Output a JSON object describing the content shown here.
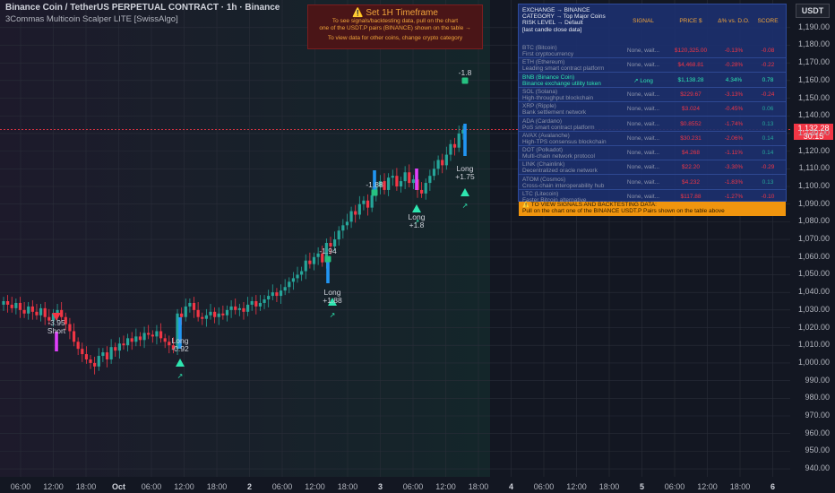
{
  "header": {
    "title": "Binance Coin / TetherUS PERPETUAL CONTRACT · 1h · Binance",
    "indicator": "3Commas Multicoin Scalper LITE [SwissAlgo]",
    "currency": "USDT"
  },
  "price_tag": {
    "price": "1,132.28",
    "countdown": "30:15"
  },
  "warning": {
    "title": "⚠️  Set 1H Timeframe",
    "line1": "To see signals/backtesting data, pull on the chart",
    "line2": "one of the USDT.P pairs (BINANCE) shown on the table →",
    "line3": "To view data for other coins, change crypto category"
  },
  "info_table": {
    "header_lines": [
      "EXCHANGE → BINANCE",
      "CATEGORY → Top Major Coins",
      "RISK LEVEL → Default"
    ],
    "note": "[last candle close data]",
    "columns": [
      "SIGNAL",
      "PRICE $",
      "Δ% vs. D.O.",
      "SCORE"
    ],
    "rows": [
      {
        "name": "BTC (Bitcoin)",
        "desc": "First cryptocurrency",
        "signal": "None, wait...",
        "price": "$120,325.00",
        "delta": "-0.13%",
        "score": "-0.08",
        "score_neg": true
      },
      {
        "name": "ETH (Ethereum)",
        "desc": "Leading smart contract platform",
        "signal": "None, wait...",
        "price": "$4,468.81",
        "delta": "-0.28%",
        "score": "-0.22",
        "score_neg": true
      },
      {
        "name": "BNB (Binance Coin)",
        "desc": "Binance exchange utility token",
        "signal": "↗ Long",
        "price": "$1,138.28",
        "delta": "4.34%",
        "score": "0.78",
        "score_neg": false,
        "highlight": true
      },
      {
        "name": "SOL (Solana)",
        "desc": "High-throughput blockchain",
        "signal": "None, wait...",
        "price": "$229.67",
        "delta": "-3.13%",
        "score": "-0.24",
        "score_neg": true
      },
      {
        "name": "XRP (Ripple)",
        "desc": "Bank settlement network",
        "signal": "None, wait...",
        "price": "$3.024",
        "delta": "-0.45%",
        "score": "0.06",
        "score_neg": false
      },
      {
        "name": "ADA (Cardano)",
        "desc": "PoS smart contract platform",
        "signal": "None, wait...",
        "price": "$0.8552",
        "delta": "-1.74%",
        "score": "0.13",
        "score_neg": false
      },
      {
        "name": "AVAX (Avalanche)",
        "desc": "High-TPS consensus blockchain",
        "signal": "None, wait...",
        "price": "$30.231",
        "delta": "-2.06%",
        "score": "0.14",
        "score_neg": false
      },
      {
        "name": "DOT (Polkadot)",
        "desc": "Multi-chain network protocol",
        "signal": "None, wait...",
        "price": "$4.268",
        "delta": "-1.11%",
        "score": "0.14",
        "score_neg": false
      },
      {
        "name": "LINK (Chainlink)",
        "desc": "Decentralized oracle network",
        "signal": "None, wait...",
        "price": "$22.20",
        "delta": "-3.30%",
        "score": "-0.29",
        "score_neg": true
      },
      {
        "name": "ATOM (Cosmos)",
        "desc": "Cross-chain interoperability hub",
        "signal": "None, wait...",
        "price": "$4.232",
        "delta": "-1.83%",
        "score": "0.13",
        "score_neg": false
      },
      {
        "name": "LTC (Litecoin)",
        "desc": "Faster Bitcoin alternative",
        "signal": "None, wait...",
        "price": "$117.88",
        "delta": "-1.27%",
        "score": "-0.10",
        "score_neg": true
      }
    ],
    "footer_line1": "⚠️  TO VIEW SIGNALS AND BACKTESTING DATA:",
    "footer_line2": "Pull on the chart one of the BINANCE USDT.P Pairs shown on the table above"
  },
  "chart_data": {
    "type": "candlestick",
    "y_axis_ticks": [
      "1,190.00",
      "1,180.00",
      "1,170.00",
      "1,160.00",
      "1,150.00",
      "1,140.00",
      "1,130.00",
      "1,120.00",
      "1,110.00",
      "1,100.00",
      "1,090.00",
      "1,080.00",
      "1,070.00",
      "1,060.00",
      "1,050.00",
      "1,040.00",
      "1,030.00",
      "1,020.00",
      "1,010.00",
      "1,000.00",
      "990.00",
      "980.00",
      "970.00",
      "960.00",
      "950.00",
      "940.00"
    ],
    "ylim": [
      938,
      1197
    ],
    "x_axis_ticks": [
      {
        "label": "06:00"
      },
      {
        "label": "12:00"
      },
      {
        "label": "18:00"
      },
      {
        "label": "Oct",
        "strong": true
      },
      {
        "label": "06:00"
      },
      {
        "label": "12:00"
      },
      {
        "label": "18:00"
      },
      {
        "label": "2",
        "strong": true
      },
      {
        "label": "06:00"
      },
      {
        "label": "12:00"
      },
      {
        "label": "18:00"
      },
      {
        "label": "3",
        "strong": true
      },
      {
        "label": "06:00"
      },
      {
        "label": "12:00"
      },
      {
        "label": "18:00"
      },
      {
        "label": "4",
        "strong": true
      },
      {
        "label": "06:00"
      },
      {
        "label": "12:00"
      },
      {
        "label": "18:00"
      },
      {
        "label": "5",
        "strong": true
      },
      {
        "label": "06:00"
      },
      {
        "label": "12:00"
      },
      {
        "label": "18:00"
      },
      {
        "label": "6",
        "strong": true
      }
    ],
    "current_price": 1132.28,
    "close_series": [
      1035,
      1033,
      1031,
      1034,
      1030,
      1028,
      1032,
      1029,
      1027,
      1031,
      1026,
      1024,
      1028,
      1030,
      1026,
      1022,
      1018,
      1012,
      1008,
      1005,
      1002,
      1000,
      998,
      1004,
      1006,
      1002,
      1009,
      1007,
      1011,
      1010,
      1014,
      1012,
      1015,
      1013,
      1017,
      1016,
      1015,
      1018,
      1014,
      1012,
      1010,
      1008,
      1028,
      1026,
      1032,
      1034,
      1030,
      1026,
      1025,
      1027,
      1029,
      1026,
      1028,
      1027,
      1030,
      1032,
      1030,
      1031,
      1029,
      1033,
      1035,
      1032,
      1034,
      1036,
      1038,
      1040,
      1038,
      1041,
      1043,
      1046,
      1048,
      1050,
      1052,
      1058,
      1056,
      1060,
      1062,
      1057,
      1068,
      1066,
      1070,
      1075,
      1078,
      1080,
      1086,
      1084,
      1090,
      1092,
      1088,
      1095,
      1100,
      1103,
      1098,
      1105,
      1106,
      1100,
      1103,
      1108,
      1102,
      1104,
      1098,
      1096,
      1102,
      1106,
      1110,
      1115,
      1112,
      1118,
      1124,
      1122,
      1130,
      1132
    ],
    "signals": [
      {
        "type": "Short",
        "value": "-3.95"
      },
      {
        "type": "Long",
        "value": "-0.92"
      },
      {
        "type": "Long",
        "value": "-1.94"
      },
      {
        "type": "Long",
        "value": "+1.88"
      },
      {
        "type": "Long",
        "value": "-1.88"
      },
      {
        "type": "Long",
        "value": "+1.8"
      },
      {
        "type": "Long",
        "value": "-1.8"
      },
      {
        "type": "Long",
        "value": "+1.75"
      }
    ]
  },
  "colors": {
    "bull": "#26a69a",
    "bear": "#f23645",
    "long_marker": "#2ee6b0",
    "short_marker": "#f23645",
    "cyan_bar": "#2196f3",
    "magenta_bar": "#e040fb"
  }
}
